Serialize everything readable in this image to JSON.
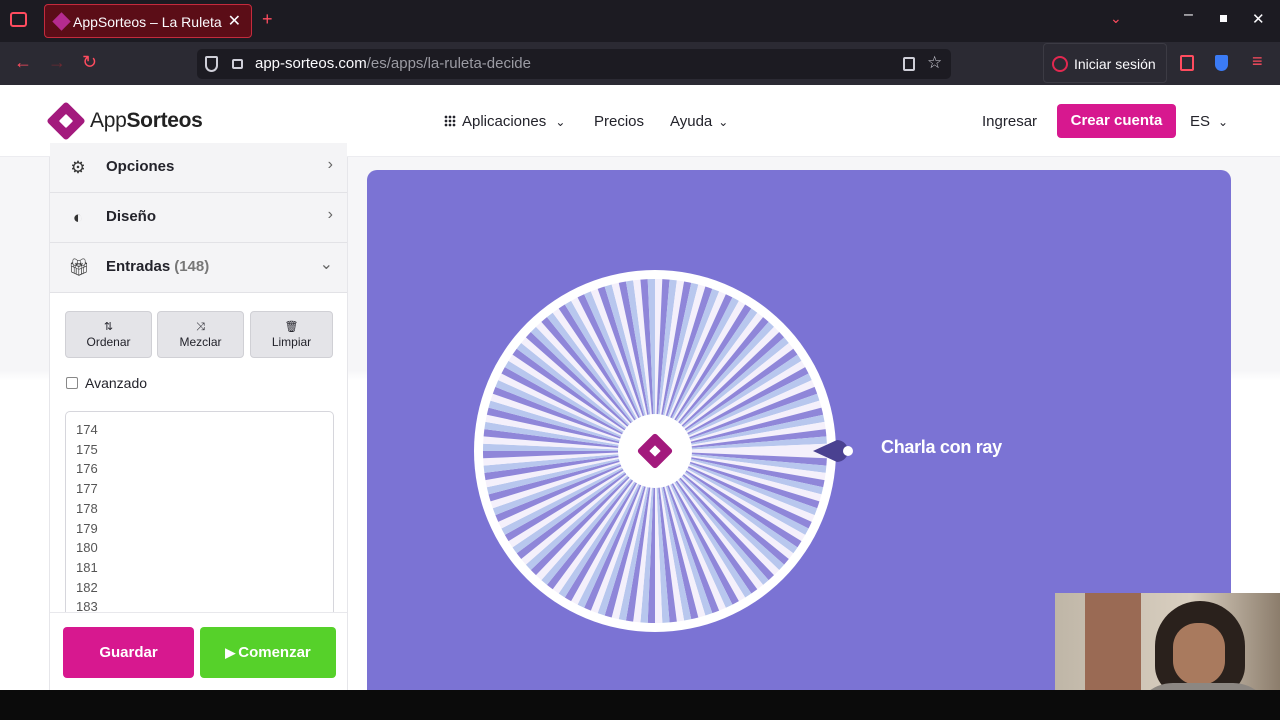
{
  "browser": {
    "tab_title": "AppSorteos – La Ruleta d",
    "url_host": "app-sorteos.com",
    "url_path": "/es/apps/la-ruleta-decide",
    "signin_label": "Iniciar sesión"
  },
  "header": {
    "logo_app": "App",
    "logo_sorteos": "Sorteos",
    "nav": {
      "aplicaciones": "Aplicaciones",
      "precios": "Precios",
      "ayuda": "Ayuda"
    },
    "ingresar": "Ingresar",
    "crear_cuenta": "Crear cuenta",
    "lang": "ES"
  },
  "sidebar": {
    "opciones": "Opciones",
    "diseno": "Diseño",
    "entradas": "Entradas",
    "entradas_count": "(148)",
    "tools": {
      "ordenar": "Ordenar",
      "mezclar": "Mezclar",
      "limpiar": "Limpiar"
    },
    "avanzado": "Avanzado",
    "entries": [
      "174",
      "175",
      "176",
      "177",
      "178",
      "179",
      "180",
      "181",
      "182",
      "183"
    ],
    "guardar": "Guardar",
    "comenzar": "Comenzar"
  },
  "wheel": {
    "winner": "Charla con ray",
    "segments": 148,
    "colors": [
      "#f4f0fb",
      "#8f86d9",
      "#b8c7ee"
    ]
  }
}
